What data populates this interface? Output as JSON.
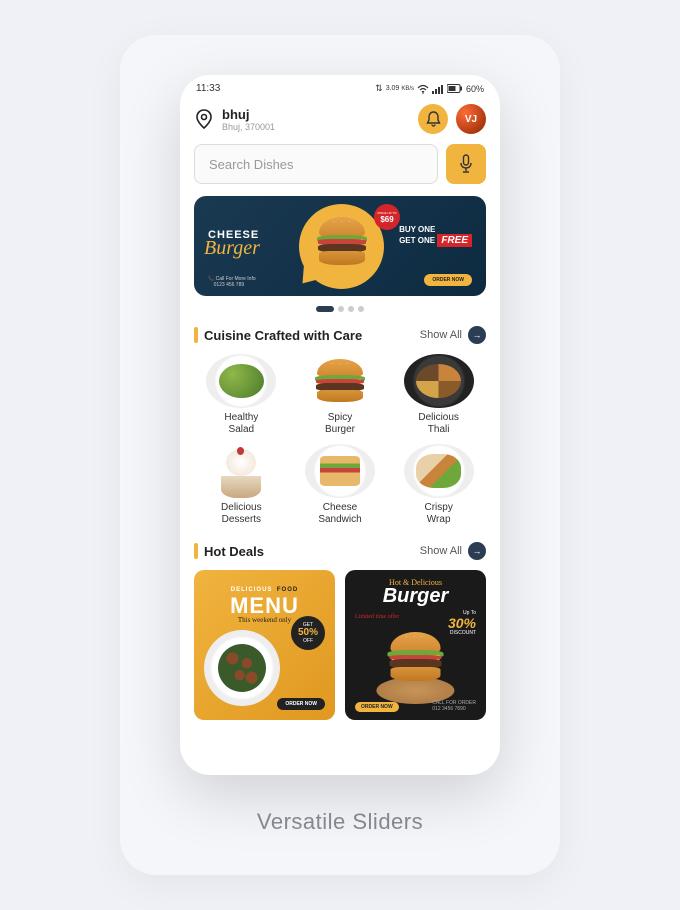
{
  "status": {
    "time": "11:33",
    "speed_label": "3.09",
    "speed_unit": "KB/s",
    "battery": "60%"
  },
  "header": {
    "location_title": "bhuj",
    "location_sub": "Bhuj, 370001",
    "avatar_initials": "VJ"
  },
  "search": {
    "placeholder": "Search Dishes"
  },
  "hero": {
    "title_top": "CHEESE",
    "title_script": "Burger",
    "call_label": "Call For More Info",
    "call_number": "0123 456 789",
    "price_prefix": "PRICE UP TO",
    "price": "$69",
    "bogo_line1": "BUY ONE",
    "bogo_line2": "GET ONE",
    "bogo_free": "FREE",
    "order_btn": "ORDER NOW"
  },
  "sections": {
    "cuisine": {
      "title": "Cuisine Crafted with Care",
      "show_all": "Show All",
      "items": [
        {
          "label": "Healthy Salad"
        },
        {
          "label": "Spicy Burger"
        },
        {
          "label": "Delicious Thali"
        },
        {
          "label": "Delicious Desserts"
        },
        {
          "label": "Cheese Sandwich"
        },
        {
          "label": "Crispy Wrap"
        }
      ]
    },
    "hot_deals": {
      "title": "Hot Deals",
      "show_all": "Show All"
    }
  },
  "deal_yellow": {
    "line1a": "DELICIOUS",
    "line1b": "FOOD",
    "menu": "MENU",
    "subtitle": "This weekend only",
    "get": "GET",
    "percent": "50%",
    "off": "OFF",
    "order": "ORDER NOW"
  },
  "deal_dark": {
    "hot": "Hot & Delicious",
    "burger": "Burger",
    "limited": "Limited time offer",
    "upto": "Up To",
    "percent": "30%",
    "discount": "DISCOUNT",
    "order": "ORDER NOW",
    "phone_label": "CALL FOR ORDER",
    "phone": "012 3456 7890"
  },
  "tagline": "Versatile Sliders"
}
